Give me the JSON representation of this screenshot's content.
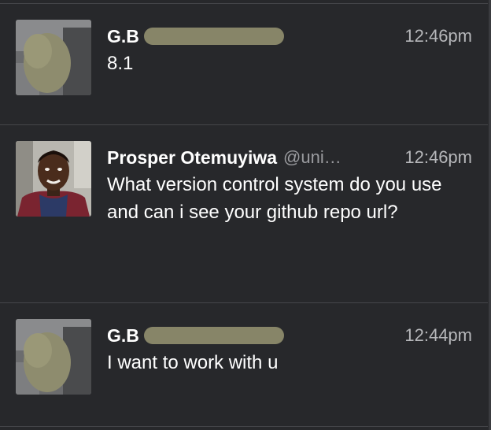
{
  "tweets": [
    {
      "name": "G.B",
      "handle": "",
      "time": "12:46pm",
      "text": "8.1",
      "avatar": "blurred-avatar"
    },
    {
      "name": "Prosper Otemuyiwa",
      "handle": "@uni…",
      "time": "12:46pm",
      "text": "What version control system do you use and can i see your github repo url?",
      "avatar": "profile-photo"
    },
    {
      "name": "G.B",
      "handle": "",
      "time": "12:44pm",
      "text": "I want to work with u",
      "avatar": "blurred-avatar"
    }
  ],
  "colors": {
    "background": "#27282b",
    "divider": "#45464a",
    "name": "#ffffff",
    "handle": "#9a9b9f",
    "time": "#b6b7ba",
    "redaction": "#8c8a6c"
  }
}
